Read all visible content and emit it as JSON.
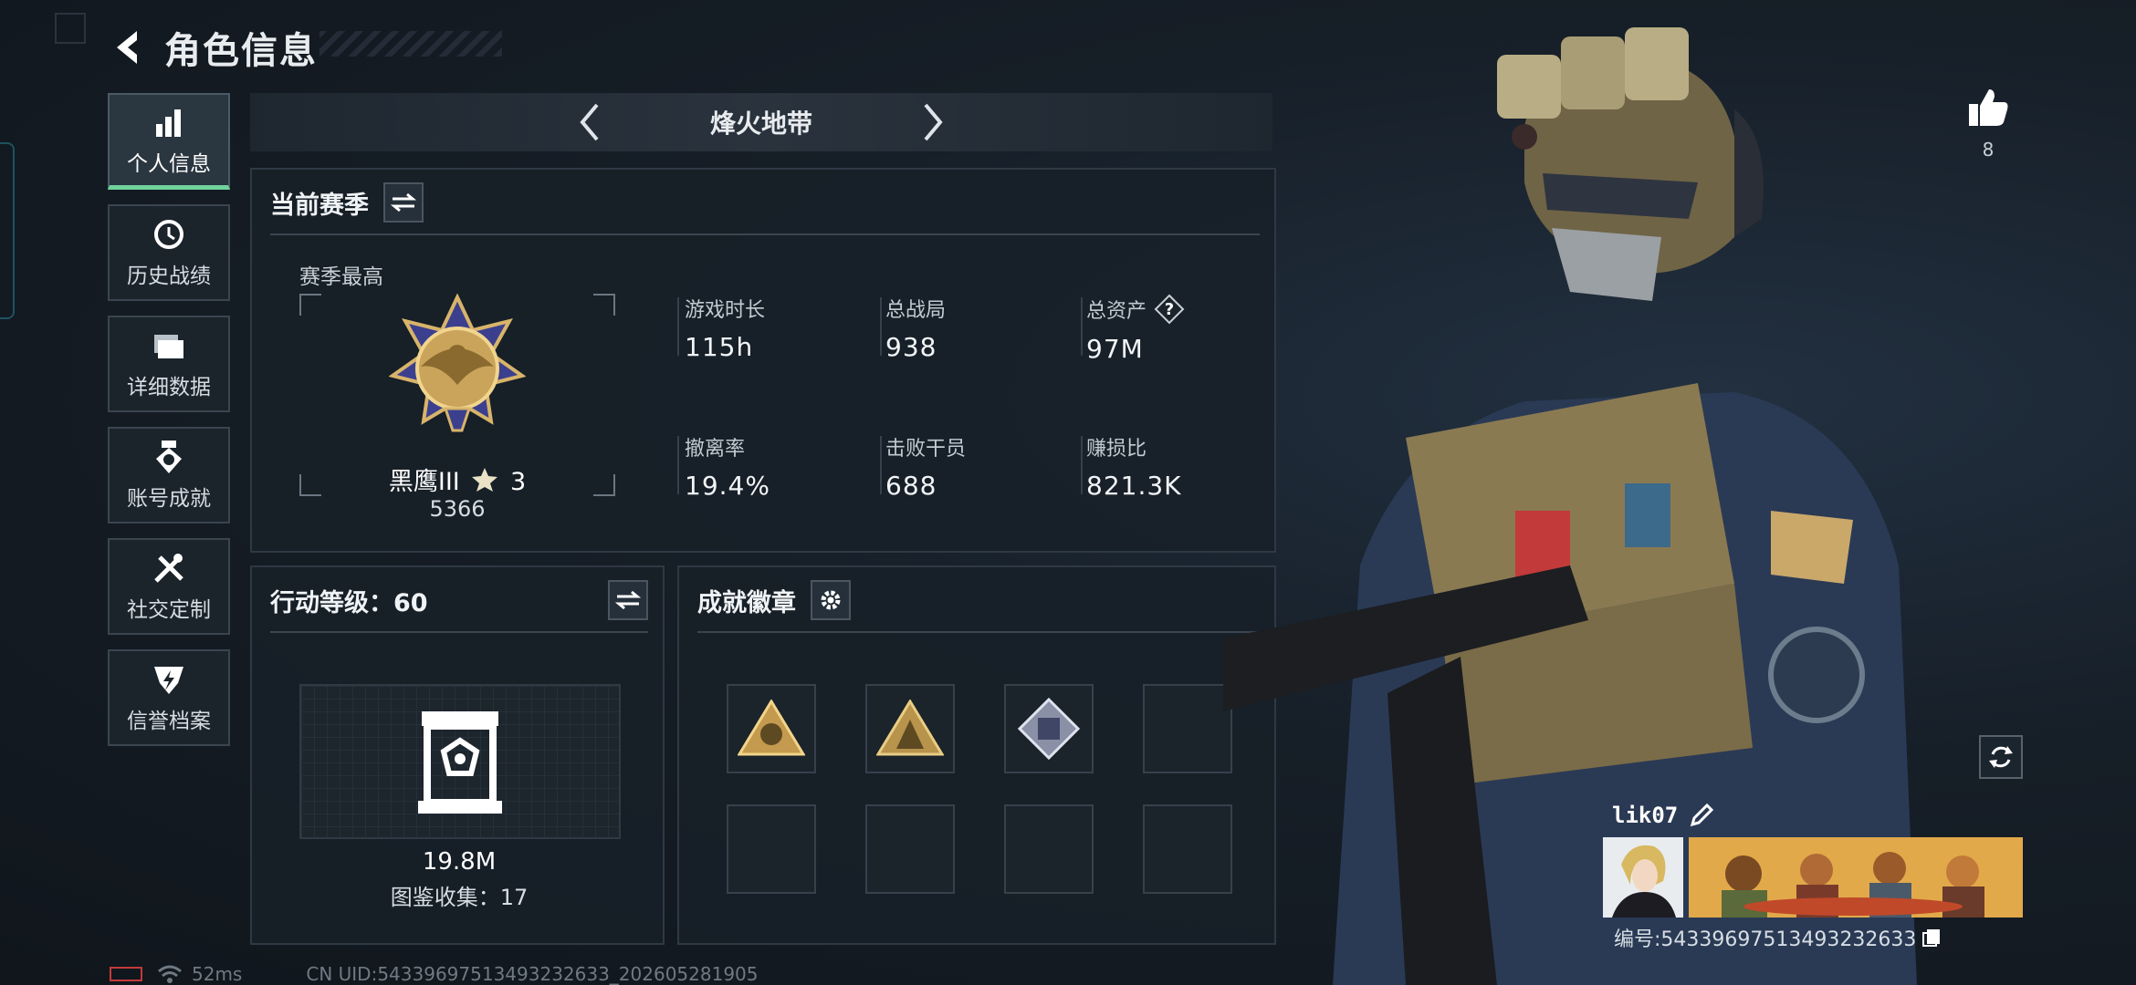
{
  "header": {
    "title": "角色信息"
  },
  "sidebar": {
    "items": [
      {
        "label": "个人信息",
        "icon": "bar-chart-icon",
        "active": true
      },
      {
        "label": "历史战绩",
        "icon": "history-clock-icon"
      },
      {
        "label": "详细数据",
        "icon": "folder-icon"
      },
      {
        "label": "账号成就",
        "icon": "medal-icon"
      },
      {
        "label": "社交定制",
        "icon": "tools-icon"
      },
      {
        "label": "信誉档案",
        "icon": "shield-lightning-icon"
      }
    ]
  },
  "mode": {
    "name": "烽火地带"
  },
  "season": {
    "title": "当前赛季",
    "best_label": "赛季最高",
    "rank_name": "黑鹰III",
    "rank_stars": "3",
    "rank_score": "5366",
    "stats": [
      {
        "label": "游戏时长",
        "value": "115h"
      },
      {
        "label": "总战局",
        "value": "938"
      },
      {
        "label": "总资产",
        "value": "97M",
        "help": "?"
      },
      {
        "label": "撤离率",
        "value": "19.4%"
      },
      {
        "label": "击败干员",
        "value": "688"
      },
      {
        "label": "赚损比",
        "value": "821.3K"
      }
    ]
  },
  "level": {
    "title": "行动等级：60",
    "value": "19.8M",
    "collection": "图鉴收集：17"
  },
  "achievements": {
    "title": "成就徽章"
  },
  "profile": {
    "likes": "8",
    "name": "lik07",
    "uid_label": "编号:5433969751349323263​3"
  },
  "statusbar": {
    "ping": "52ms",
    "uid": "CN UID:54339697513493232633_202605281905"
  },
  "colors": {
    "accent": "#6fd39b",
    "battery": "#c43a3a"
  }
}
